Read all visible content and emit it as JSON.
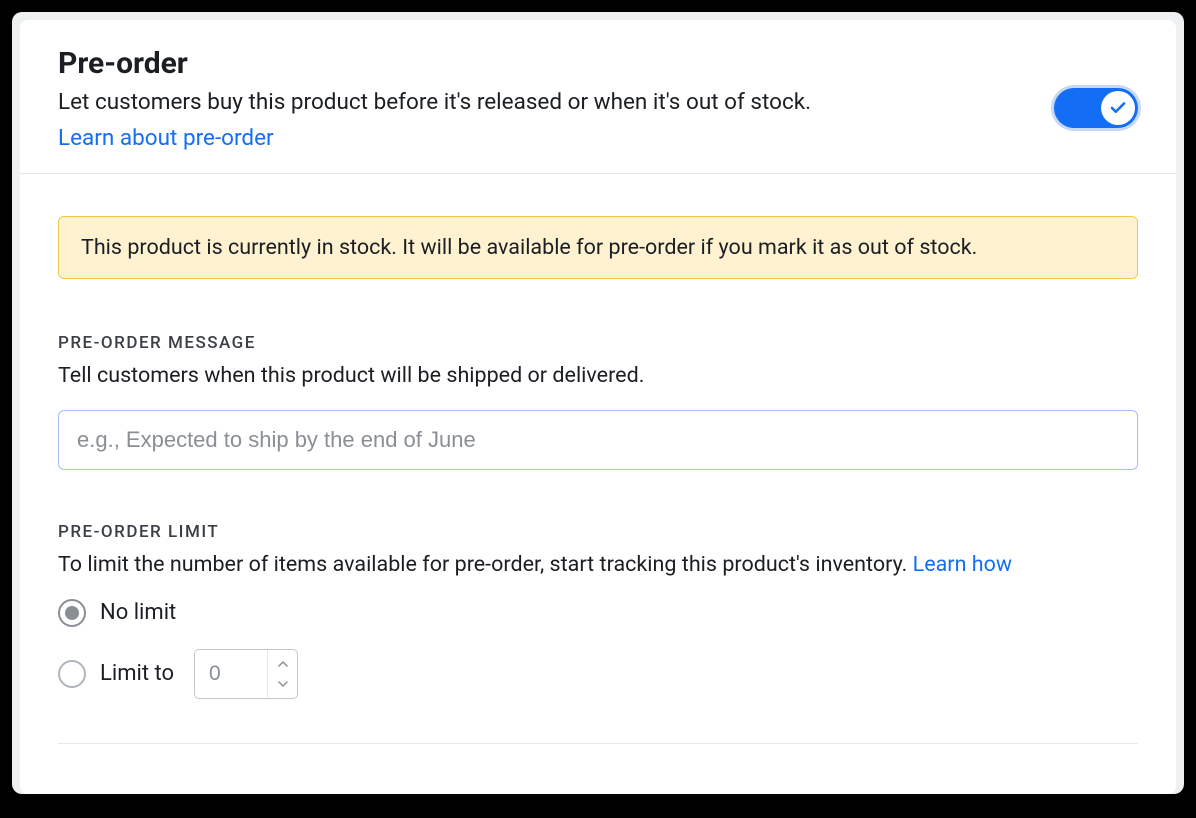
{
  "header": {
    "title": "Pre-order",
    "subtitle": "Let customers buy this product before it's released or when it's out of stock.",
    "learn_link": "Learn about pre-order",
    "toggle_on": true
  },
  "alert": {
    "text": "This product is currently in stock. It will be available for pre-order if you mark it as out of stock."
  },
  "message_section": {
    "label": "PRE-ORDER MESSAGE",
    "description": "Tell customers when this product will be shipped or delivered.",
    "placeholder": "e.g., Expected to ship by the end of June",
    "value": ""
  },
  "limit_section": {
    "label": "PRE-ORDER LIMIT",
    "description_prefix": "To limit the number of items available for pre-order, start tracking this product's inventory. ",
    "learn_link": "Learn how",
    "options": {
      "no_limit_label": "No limit",
      "limit_to_label": "Limit to",
      "limit_value": "0",
      "selected": "no_limit"
    }
  }
}
